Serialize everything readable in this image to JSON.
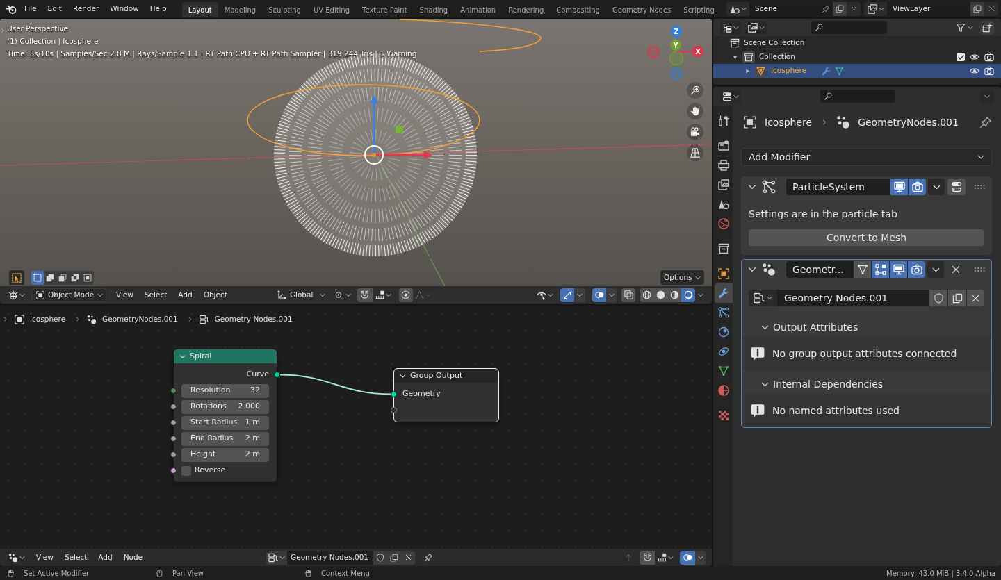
{
  "top_bar": {
    "menus": [
      "File",
      "Edit",
      "Render",
      "Window",
      "Help"
    ],
    "workspaces": [
      {
        "label": "Layout",
        "selected": true
      },
      {
        "label": "Modeling",
        "selected": false
      },
      {
        "label": "Sculpting",
        "selected": false
      },
      {
        "label": "UV Editing",
        "selected": false
      },
      {
        "label": "Texture Paint",
        "selected": false
      },
      {
        "label": "Shading",
        "selected": false
      },
      {
        "label": "Animation",
        "selected": false
      },
      {
        "label": "Rendering",
        "selected": false
      },
      {
        "label": "Compositing",
        "selected": false
      },
      {
        "label": "Geometry Nodes",
        "selected": false
      },
      {
        "label": "Scripting",
        "selected": false
      }
    ],
    "scene": "Scene",
    "view_layer": "ViewLayer"
  },
  "viewport": {
    "info_lines": [
      "User Perspective",
      "(1) Collection | Icosphere",
      "Time: 3s/10s | Samples/Sec 2.8 M | Rays/Sample 1.1 | RT Path CPU + RT Path Sampler | 319,244 Tris | 1 Warning"
    ],
    "gizmo_axes": [
      {
        "label": "Z",
        "color": "#2f7fdc"
      },
      {
        "label": "Y",
        "color": "#6ea033"
      },
      {
        "label": "X",
        "color": "#e1364e"
      }
    ],
    "select_modes": [
      {
        "kind": "set",
        "selected": true
      },
      {
        "kind": "extend",
        "selected": false
      },
      {
        "kind": "subtract",
        "selected": false
      },
      {
        "kind": "difference",
        "selected": false
      },
      {
        "kind": "intersect",
        "selected": false
      }
    ],
    "options": "Options",
    "header": {
      "mode": "Object Mode",
      "menus": [
        "View",
        "Select",
        "Add",
        "Object"
      ],
      "orientation": "Global",
      "toggles": [
        {
          "kind": "snap",
          "on": false
        },
        {
          "kind": "proportional",
          "on": false
        },
        {
          "kind": "gizmos",
          "on": true
        },
        {
          "kind": "overlays",
          "on": true
        },
        {
          "kind": "xray",
          "on": false
        }
      ],
      "shading": [
        {
          "kind": "wireframe",
          "selected": false
        },
        {
          "kind": "solid",
          "selected": false
        },
        {
          "kind": "material",
          "selected": false
        },
        {
          "kind": "rendered",
          "selected": true
        }
      ]
    }
  },
  "node_editor": {
    "breadcrumbs": [
      {
        "kind": "object",
        "label": "Icosphere"
      },
      {
        "kind": "modifier",
        "label": "GeometryNodes.001"
      },
      {
        "kind": "node_tree",
        "label": "Geometry Nodes.001"
      }
    ],
    "nodes": [
      {
        "kind": "spiral",
        "title": "Spiral",
        "selected": false,
        "outputs": [
          {
            "label": "Curve",
            "color": "#00d6a3"
          }
        ],
        "inputs": [
          {
            "kind": "value",
            "label": "Resolution",
            "value": "32",
            "color": "#598c5c"
          },
          {
            "kind": "value",
            "label": "Rotations",
            "value": "2.000",
            "color": "#a1a1a1"
          },
          {
            "kind": "value",
            "label": "Start Radius",
            "value": "1 m",
            "color": "#a1a1a1"
          },
          {
            "kind": "value",
            "label": "End Radius",
            "value": "2 m",
            "color": "#a1a1a1"
          },
          {
            "kind": "value",
            "label": "Height",
            "value": "2 m",
            "color": "#a1a1a1"
          },
          {
            "kind": "checkbox",
            "label": "Reverse",
            "checked": false,
            "color": "#cca6d6"
          }
        ]
      },
      {
        "kind": "group_output",
        "title": "Group Output",
        "selected": true,
        "inputs": [
          {
            "kind": "socket",
            "label": "Geometry",
            "color": "#00d6a3",
            "connected": true
          },
          {
            "kind": "empty"
          }
        ]
      }
    ],
    "header": {
      "menus": [
        "View",
        "Select",
        "Add",
        "Node"
      ],
      "node_tree": "Geometry Nodes.001",
      "toggles": [
        {
          "kind": "snap",
          "on": false
        },
        {
          "kind": "overlays",
          "on": true
        }
      ]
    }
  },
  "outliner": {
    "tree": [
      {
        "kind": "scene_collection",
        "label": "Scene Collection",
        "selected": false,
        "children": [
          {
            "kind": "collection",
            "label": "Collection",
            "selected": false,
            "expanded": true,
            "checked": true,
            "children": [
              {
                "kind": "object",
                "label": "Icosphere",
                "selected": true,
                "expanded": false
              }
            ]
          }
        ]
      }
    ]
  },
  "properties": {
    "tabs": [
      {
        "kind": "tool",
        "selected": false
      },
      {
        "kind": "render",
        "selected": false
      },
      {
        "kind": "output",
        "selected": false
      },
      {
        "kind": "view_layer",
        "selected": false
      },
      {
        "kind": "scene",
        "selected": false
      },
      {
        "kind": "world",
        "selected": false
      },
      {
        "kind": "collection",
        "selected": false
      },
      {
        "kind": "object",
        "selected": false
      },
      {
        "kind": "modifiers",
        "selected": true
      },
      {
        "kind": "particles",
        "selected": false
      },
      {
        "kind": "physics",
        "selected": false
      },
      {
        "kind": "constraints",
        "selected": false
      },
      {
        "kind": "data",
        "selected": false
      },
      {
        "kind": "material",
        "selected": false
      },
      {
        "kind": "texture",
        "selected": false
      }
    ],
    "breadcrumbs": [
      {
        "kind": "object",
        "label": "Icosphere"
      },
      {
        "kind": "modifier",
        "label": "GeometryNodes.001"
      }
    ],
    "add_modifier": "Add Modifier",
    "modifiers": [
      {
        "kind": "particle_system",
        "name": "ParticleSystem",
        "expanded": true,
        "active": false,
        "toggles": [
          {
            "kind": "viewport",
            "on": true
          },
          {
            "kind": "render",
            "on": true
          }
        ],
        "message": "Settings are in the particle tab",
        "button": "Convert to Mesh"
      },
      {
        "kind": "nodes",
        "name": "Geometr...",
        "expanded": true,
        "active": true,
        "toggles": [
          {
            "kind": "edit_mode",
            "on": false
          },
          {
            "kind": "on_cage",
            "on": true
          },
          {
            "kind": "viewport",
            "on": true
          },
          {
            "kind": "render",
            "on": true
          }
        ],
        "node_group": "Geometry Nodes.001",
        "subpanels": [
          {
            "title": "Output Attributes",
            "expanded": true,
            "info": "No group output attributes connected"
          },
          {
            "title": "Internal Dependencies",
            "expanded": true,
            "info": "No named attributes used"
          }
        ]
      }
    ]
  },
  "status_bar": {
    "hints": [
      {
        "kind": "left_click",
        "label": "Set Active Modifier"
      },
      {
        "kind": "middle_drag",
        "label": "Pan View"
      },
      {
        "kind": "right_click",
        "label": "Context Menu"
      }
    ],
    "info": "Memory: 43.0 MiB | 3.4.0 Alpha"
  }
}
